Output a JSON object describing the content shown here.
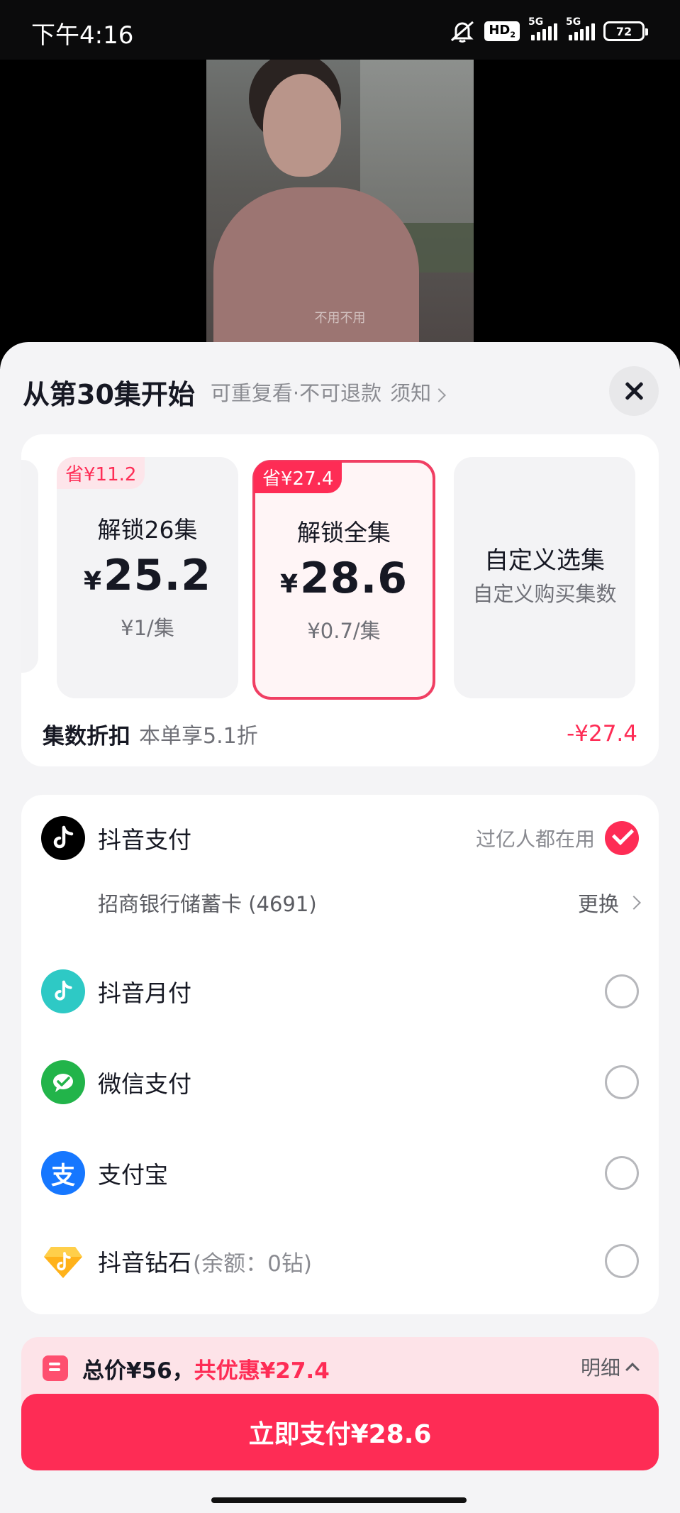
{
  "status_bar": {
    "time": "下午4:16",
    "hd_badge": "HD",
    "hd_sub": "2",
    "network_1": "5G",
    "network_2": "5G",
    "battery": "72"
  },
  "video": {
    "subtitle": "不用不用"
  },
  "sheet": {
    "title": "从第30集开始",
    "subtitle": "可重复看·不可退款",
    "notice_link": "须知"
  },
  "plans": [
    {
      "badge": "省¥11.2",
      "name": "解锁26集",
      "currency": "¥",
      "price": "25.2",
      "per": "¥1/集",
      "selected": false
    },
    {
      "badge": "省¥27.4",
      "name": "解锁全集",
      "currency": "¥",
      "price": "28.6",
      "per": "¥0.7/集",
      "selected": true
    },
    {
      "title": "自定义选集",
      "subtitle": "自定义购买集数"
    }
  ],
  "discount": {
    "label": "集数折扣",
    "desc": "本单享5.1折",
    "amount": "-¥27.4"
  },
  "payment": {
    "methods": [
      {
        "icon": "douyin-icon",
        "name": "抖音支付",
        "tag": "过亿人都在用",
        "selected": true,
        "color": "#000000"
      },
      {
        "icon": "douyin-monthly-icon",
        "name": "抖音月付",
        "selected": false,
        "color": "#2ec9c5"
      },
      {
        "icon": "wechat-pay-icon",
        "name": "微信支付",
        "selected": false,
        "color": "#22b44a"
      },
      {
        "icon": "alipay-icon",
        "name": "支付宝",
        "selected": false,
        "color": "#1677ff"
      },
      {
        "icon": "douyin-diamond-icon",
        "name": "抖音钻石",
        "note": "(余额：0钻)",
        "selected": false,
        "color": "#ffb21a"
      }
    ],
    "card": {
      "name": "招商银行储蓄卡 (4691)",
      "change_label": "更换"
    }
  },
  "total": {
    "text": "总价¥56，",
    "save": "共优惠¥27.4",
    "detail_label": "明细"
  },
  "pay_button": {
    "label": "立即支付¥28.6"
  },
  "colors": {
    "accent": "#fe2c55",
    "sheet_bg": "#f4f4f6"
  }
}
